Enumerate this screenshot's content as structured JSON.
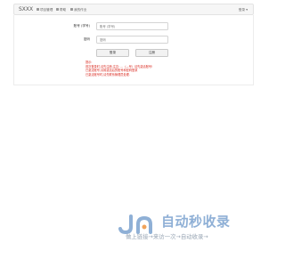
{
  "navbar": {
    "brand": "SXXX",
    "items": [
      {
        "label": "项目管理",
        "icon": "grid-icon"
      },
      {
        "label": "帮助",
        "icon": "info-icon"
      },
      {
        "label": "我的作业",
        "icon": "doc-icon"
      }
    ],
    "user_menu": "登录 ▾"
  },
  "form": {
    "account_label": "账号 (学号)",
    "account_placeholder": "账号 (学号)",
    "password_label": "密码",
    "password_placeholder": "密码",
    "login_button": "登录",
    "register_button": "注册"
  },
  "notice": {
    "title": "提示:",
    "lines": [
      "首次登录时,请先注册,注意: ...（—号）请先激活账号!",
      "已激活账号,请用激活后的账号和密码登录",
      "已激活账号时,请先联系管理员处理."
    ]
  },
  "watermark": {
    "title": "自动秒收录",
    "subtitle": "做上链接→来访一次→自动收录→"
  },
  "colors": {
    "accent_red": "#d9261c",
    "watermark_blue": "#8fb0d6"
  }
}
